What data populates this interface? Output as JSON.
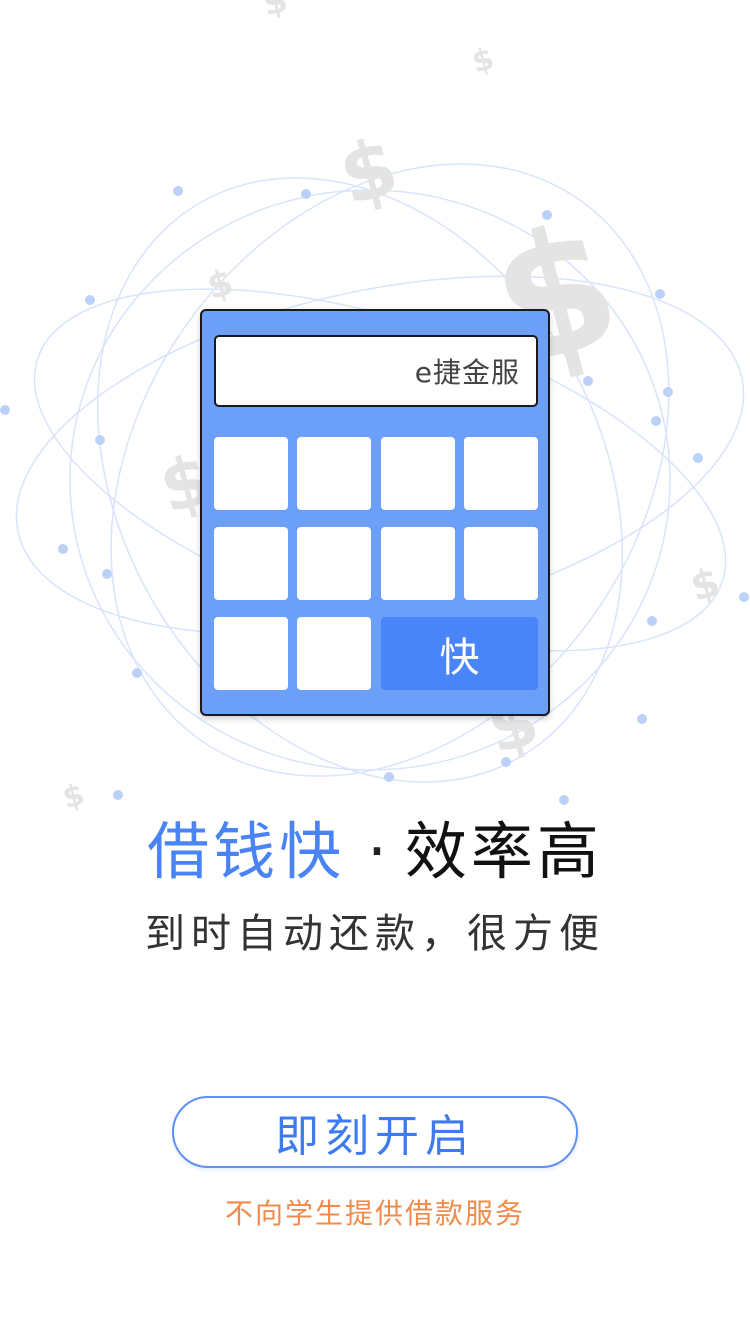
{
  "calculator": {
    "screen_text": "e捷金服",
    "fast_key_label": "快"
  },
  "headline": {
    "part1": "借钱快",
    "separator": "·",
    "part2": "效率高"
  },
  "subline": "到时自动还款，很方便",
  "start_button_label": "即刻开启",
  "notice": "不向学生提供借款服务",
  "colors": {
    "accent_blue": "#4a84f4",
    "calculator_body": "#6b9ff8",
    "notice_orange": "#f08b4b"
  },
  "background_decoration": {
    "dollar_glyph": "$"
  }
}
